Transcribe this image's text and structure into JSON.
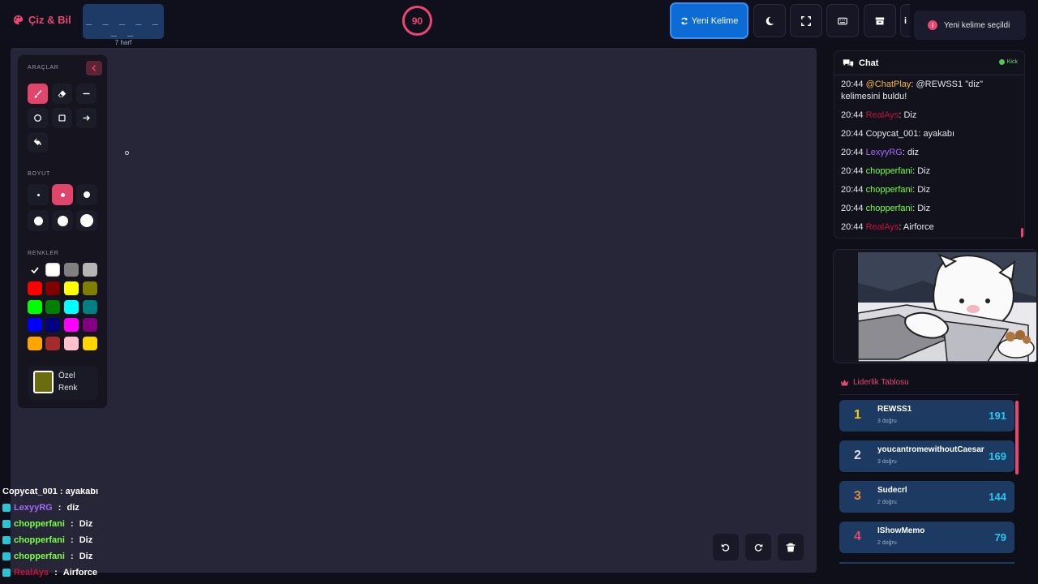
{
  "app": {
    "title": "Çiz & Bil"
  },
  "word": {
    "mask": "_ _ _ _ _ _ _",
    "letters": "7 harf"
  },
  "timer": {
    "value": "90"
  },
  "toolbar": {
    "new_word": "Yeni Kelime"
  },
  "toast": {
    "text": "Yeni kelime seçildi"
  },
  "tools_panel": {
    "tools_title": "ARAÇLAR",
    "size_title": "BOYUT",
    "colors_title": "RENKLER",
    "custom_color_label": "Özel Renk",
    "custom_color": "#6b6b0f",
    "colors": [
      "#000000",
      "#ffffff",
      "#808080",
      "#b5b5b5",
      "#ff0000",
      "#800000",
      "#ffff00",
      "#808000",
      "#00ff00",
      "#008000",
      "#00ffff",
      "#008080",
      "#0000ff",
      "#000080",
      "#ff00ff",
      "#800080",
      "#ffa500",
      "#a52a2a",
      "#ffc0cb",
      "#ffd700"
    ]
  },
  "overlay_chat": {
    "cut_line": "Copycat_001 : ayakabı",
    "lines": [
      {
        "user": "LexyyRG",
        "sep": " : ",
        "text": "diz",
        "color": "#a16bf5"
      },
      {
        "user": "chopperfani",
        "sep": " : ",
        "text": "Diz",
        "color": "#7bff45"
      },
      {
        "user": "chopperfani",
        "sep": " : ",
        "text": "Diz",
        "color": "#7bff45"
      },
      {
        "user": "chopperfani",
        "sep": " : ",
        "text": "Diz",
        "color": "#7bff45"
      },
      {
        "user": "RealAys",
        "sep": " : ",
        "text": "Airforce",
        "color": "#c4133a"
      }
    ]
  },
  "chat": {
    "title": "Chat",
    "status": "Kick",
    "messages": [
      {
        "time": "20:44",
        "user": "@ChatPlay",
        "text": ": @REWSS1 \"diz\" kelimesini buldu!",
        "color": "#f5b944"
      },
      {
        "time": "20:44",
        "user": "RealAys",
        "text": ": Diz",
        "color": "#c4133a"
      },
      {
        "time": "20:44",
        "user": "Copycat_001",
        "text": ": ayakabı",
        "color": "#e5e7eb"
      },
      {
        "time": "20:44",
        "user": "LexyyRG",
        "text": ": diz",
        "color": "#a16bf5"
      },
      {
        "time": "20:44",
        "user": "chopperfani",
        "text": ": Diz",
        "color": "#7bff45"
      },
      {
        "time": "20:44",
        "user": "chopperfani",
        "text": ": Diz",
        "color": "#7bff45"
      },
      {
        "time": "20:44",
        "user": "chopperfani",
        "text": ": Diz",
        "color": "#7bff45"
      },
      {
        "time": "20:44",
        "user": "RealAys",
        "text": ": Airforce",
        "color": "#c4133a"
      }
    ]
  },
  "leaderboard": {
    "title": "Liderlik Tablosu",
    "items": [
      {
        "rank": "1",
        "name": "REWSS1",
        "sub": "3 doğru",
        "score": "191",
        "rank_color": "#f6c90e"
      },
      {
        "rank": "2",
        "name": "youcantromewithoutCaesar",
        "sub": "3 doğru",
        "score": "169",
        "rank_color": "#d9dde6"
      },
      {
        "rank": "3",
        "name": "Sudecrl",
        "sub": "2 doğru",
        "score": "144",
        "rank_color": "#e08a3c"
      },
      {
        "rank": "4",
        "name": "IShowMemo",
        "sub": "2 doğru",
        "score": "79",
        "rank_color": "#e8476f"
      }
    ]
  }
}
